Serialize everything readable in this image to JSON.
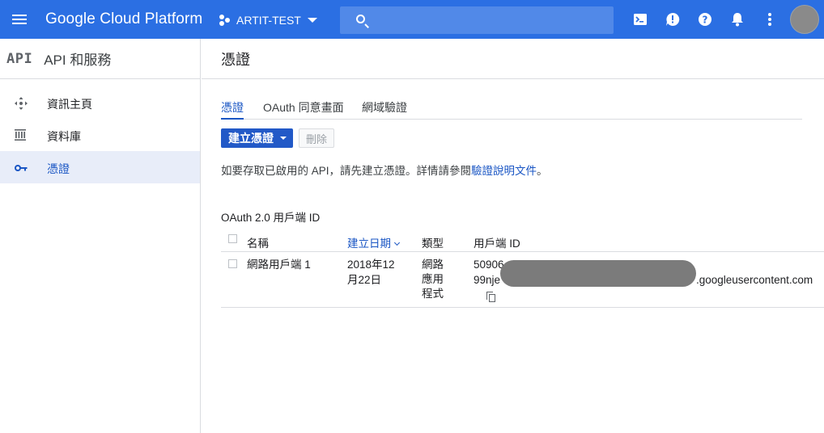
{
  "topbar": {
    "brand": "Google Cloud Platform",
    "project_name": "ARTIT-TEST",
    "search_value": "",
    "icons": [
      "menu-icon",
      "cloud-shell-icon",
      "feedback-icon",
      "help-icon",
      "notifications-icon",
      "more-vert-icon"
    ]
  },
  "sidebar": {
    "logo": "API",
    "title": "API 和服務",
    "items": [
      {
        "label": "資訊主頁",
        "icon": "dashboard-icon",
        "active": false
      },
      {
        "label": "資料庫",
        "icon": "library-icon",
        "active": false
      },
      {
        "label": "憑證",
        "icon": "key-icon",
        "active": true
      }
    ]
  },
  "main": {
    "title": "憑證",
    "tabs": [
      {
        "label": "憑證",
        "active": true
      },
      {
        "label": "OAuth 同意畫面",
        "active": false
      },
      {
        "label": "網域驗證",
        "active": false
      }
    ],
    "create_button": "建立憑證",
    "delete_button": "刪除",
    "info_text": "如要存取已啟用的 API，請先建立憑證。詳情請參閱",
    "info_link": "驗證說明文件",
    "info_suffix": "。",
    "section_title": "OAuth 2.0 用戶端 ID",
    "table": {
      "headers": {
        "name": "名稱",
        "created": "建立日期",
        "type": "類型",
        "client_id": "用戶端 ID"
      },
      "rows": [
        {
          "name": "網路用戶端 1",
          "created_line1": "2018年12",
          "created_line2": "月22日",
          "type_line1": "網路",
          "type_line2": "應用",
          "type_line3": "程式",
          "client_id_line1": "50906",
          "client_id_line2": "99nje",
          "client_id_suffix": ".googleusercontent.com"
        }
      ]
    }
  },
  "colors": {
    "topbar": "#2b6fe3",
    "accent": "#1a56c4",
    "active_nav_bg": "#e8edf9"
  }
}
